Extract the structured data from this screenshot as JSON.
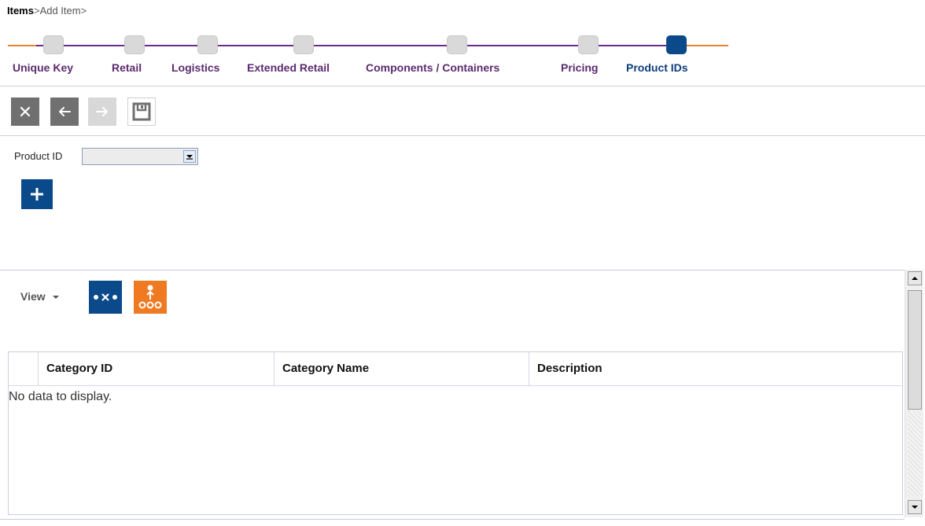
{
  "breadcrumb": {
    "root": "Items",
    "sep1": ">",
    "current": "Add Item",
    "sep2": ">"
  },
  "train": {
    "colors": {
      "line_purple": "#6a2b8a",
      "line_orange": "#e8842a",
      "active": "#0b4a8a",
      "inactive": "#d9d9d9"
    },
    "steps": [
      {
        "label": "Unique Key",
        "active": false
      },
      {
        "label": "Retail",
        "active": false
      },
      {
        "label": "Logistics",
        "active": false
      },
      {
        "label": "Extended Retail",
        "active": false
      },
      {
        "label": "Components / Containers",
        "active": false
      },
      {
        "label": "Pricing",
        "active": false
      },
      {
        "label": "Product IDs",
        "active": true
      }
    ]
  },
  "toolbar": {
    "buttons": [
      {
        "name": "cancel",
        "icon": "close-icon"
      },
      {
        "name": "back",
        "icon": "arrow-left-icon"
      },
      {
        "name": "next",
        "icon": "arrow-right-icon"
      },
      {
        "name": "save",
        "icon": "save-icon"
      }
    ]
  },
  "form": {
    "product_id_label": "Product ID",
    "product_id_value": ""
  },
  "view": {
    "label": "View",
    "icons": [
      "hierarchy-expand-icon",
      "hierarchy-tree-icon"
    ],
    "colors": {
      "blue": "#0b4a8a",
      "orange": "#f07a22"
    }
  },
  "table": {
    "columns": [
      "Category ID",
      "Category Name",
      "Description"
    ],
    "empty_message": "No data to display."
  }
}
